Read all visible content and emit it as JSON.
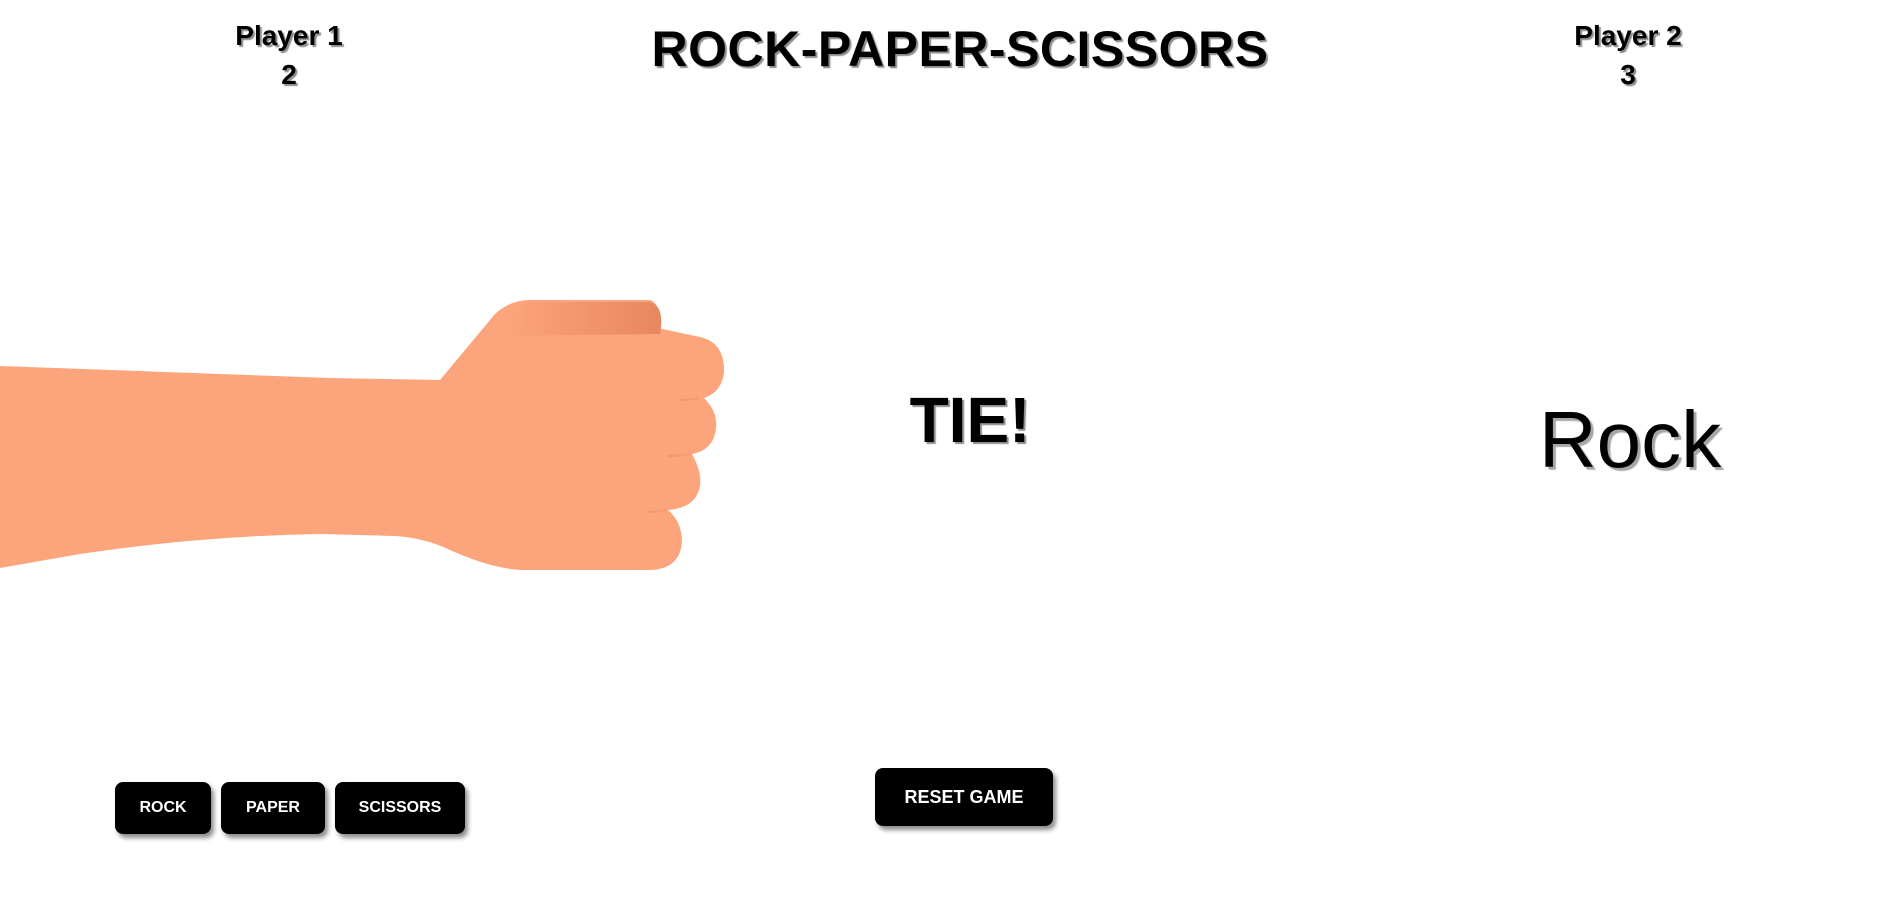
{
  "title": "ROCK-PAPER-SCISSORS",
  "player1": {
    "name": "Player 1",
    "score": "2"
  },
  "player2": {
    "name": "Player 2",
    "score": "3",
    "choice": "Rock"
  },
  "result": "TIE!",
  "controls": {
    "rock_label": "ROCK",
    "paper_label": "PAPER",
    "scissors_label": "SCISSORS",
    "reset_label": "RESET GAME"
  },
  "player1_hand": {
    "icon": "fist-hand-icon",
    "skin_color": "#FCA57D",
    "shade_color": "#E8875F"
  }
}
